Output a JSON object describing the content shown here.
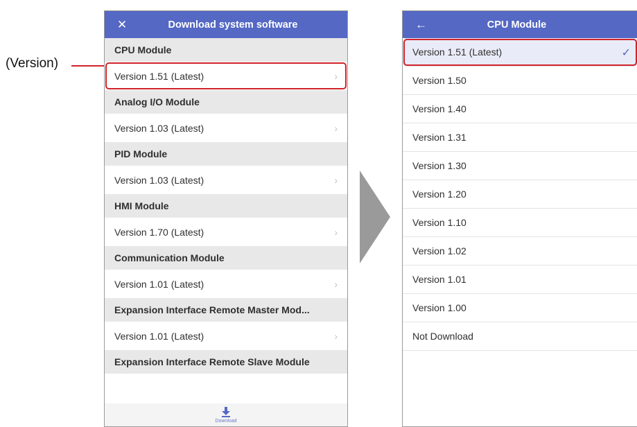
{
  "callout": {
    "label": "(Version)"
  },
  "left_screen": {
    "title": "Download system software",
    "close_icon": "close-icon",
    "sections": [
      {
        "header": "CPU Module",
        "version": "Version 1.51 (Latest)"
      },
      {
        "header": "Analog I/O Module",
        "version": "Version 1.03 (Latest)"
      },
      {
        "header": "PID Module",
        "version": "Version 1.03 (Latest)"
      },
      {
        "header": "HMI Module",
        "version": "Version 1.70 (Latest)"
      },
      {
        "header": "Communication Module",
        "version": "Version 1.01 (Latest)"
      },
      {
        "header": "Expansion Interface Remote Master Mod...",
        "version": "Version 1.01 (Latest)"
      },
      {
        "header": "Expansion Interface Remote Slave Module",
        "version": ""
      }
    ],
    "bottom_bar": {
      "label": "Download",
      "icon": "download-icon"
    }
  },
  "right_screen": {
    "title": "CPU Module",
    "back_icon": "back-arrow-icon",
    "selected_index": 0,
    "versions": [
      "Version 1.51 (Latest)",
      "Version 1.50",
      "Version 1.40",
      "Version 1.31",
      "Version 1.30",
      "Version 1.20",
      "Version 1.10",
      "Version 1.02",
      "Version 1.01",
      "Version 1.00",
      "Not Download"
    ]
  },
  "colors": {
    "appbar": "#5468c4",
    "highlight": "#d0232a",
    "section_bg": "#e8e8e8",
    "arrow": "#9a9a9a"
  }
}
